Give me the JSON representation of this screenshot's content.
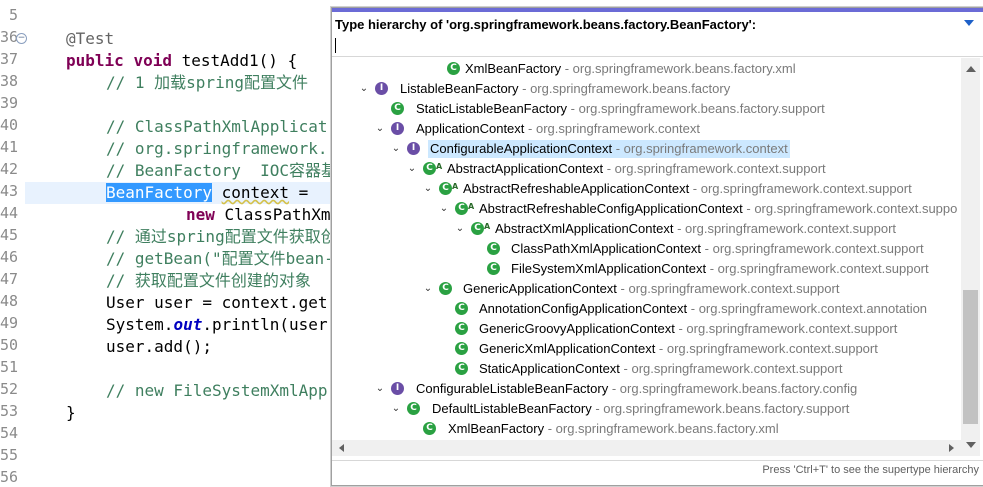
{
  "editor": {
    "line_numbers": [
      "5",
      "36",
      "37",
      "38",
      "39",
      "40",
      "41",
      "42",
      "43",
      "44",
      "45",
      "46",
      "47",
      "48",
      "49",
      "50",
      "51",
      "52",
      "53",
      "54",
      "55",
      "56"
    ],
    "lines": {
      "l36": "@Test",
      "l37_kw1": "public",
      "l37_kw2": "void",
      "l37_rest": " testAdd1() {",
      "l38": "// 1 加载spring配置文件",
      "l40": "// ClassPathXmlApplicat",
      "l41": "// org.springframework.",
      "l42": "// BeanFactory  IOC容器基",
      "l43_sel": "BeanFactory",
      "l43_var": "context",
      "l43_rest": " = ",
      "l44_kw": "new",
      "l44_rest": " ClassPathXm",
      "l45": "// 通过spring配置文件获取创",
      "l46": "// getBean(\"配置文件bean-",
      "l47": "// 获取配置文件创建的对象",
      "l48": "User user = context.get",
      "l49_a": "System.",
      "l49_field": "out",
      "l49_b": ".println(user",
      "l50": "user.add();",
      "l52": "// new FileSystemXmlApp",
      "l53": "}"
    }
  },
  "popup": {
    "title": "Type hierarchy of 'org.springframework.beans.factory.BeanFactory':",
    "filter_value": "",
    "status_text": "Press 'Ctrl+T' to see the supertype hierarchy",
    "rows": [
      {
        "name": "XmlBeanFactory",
        "pkg": " - org.springframework.beans.factory.xml"
      },
      {
        "name": "ListableBeanFactory",
        "pkg": " - org.springframework.beans.factory"
      },
      {
        "name": "StaticListableBeanFactory",
        "pkg": " - org.springframework.beans.factory.support"
      },
      {
        "name": "ApplicationContext",
        "pkg": " - org.springframework.context"
      },
      {
        "name": "ConfigurableApplicationContext",
        "pkg": " - org.springframework.context"
      },
      {
        "name": "AbstractApplicationContext",
        "pkg": " - org.springframework.context.support"
      },
      {
        "name": "AbstractRefreshableApplicationContext",
        "pkg": " - org.springframework.context.support"
      },
      {
        "name": "AbstractRefreshableConfigApplicationContext",
        "pkg": " - org.springframework.context.suppo"
      },
      {
        "name": "AbstractXmlApplicationContext",
        "pkg": " - org.springframework.context.support"
      },
      {
        "name": "ClassPathXmlApplicationContext",
        "pkg": " - org.springframework.context.support"
      },
      {
        "name": "FileSystemXmlApplicationContext",
        "pkg": " - org.springframework.context.support"
      },
      {
        "name": "GenericApplicationContext",
        "pkg": " - org.springframework.context.support"
      },
      {
        "name": "AnnotationConfigApplicationContext",
        "pkg": " - org.springframework.context.annotation"
      },
      {
        "name": "GenericGroovyApplicationContext",
        "pkg": " - org.springframework.context.support"
      },
      {
        "name": "GenericXmlApplicationContext",
        "pkg": " - org.springframework.context.support"
      },
      {
        "name": "StaticApplicationContext",
        "pkg": " - org.springframework.context.support"
      },
      {
        "name": "ConfigurableListableBeanFactory",
        "pkg": " - org.springframework.beans.factory.config"
      },
      {
        "name": "DefaultListableBeanFactory",
        "pkg": " - org.springframework.beans.factory.support"
      },
      {
        "name": "XmlBeanFactory",
        "pkg": " - org.springframework.beans.factory.xml"
      }
    ]
  },
  "colors": {
    "accent": "#6b6bd6",
    "selection": "#3399ff",
    "tree_selection": "#cce8ff",
    "interface_icon": "#6a4ea6",
    "class_icon": "#2aa142"
  },
  "icons": {
    "interface": "interface-icon",
    "class": "class-icon",
    "abstract": "abstract-marker-icon",
    "expand": "chevron-down-icon",
    "menu": "view-menu-icon"
  }
}
